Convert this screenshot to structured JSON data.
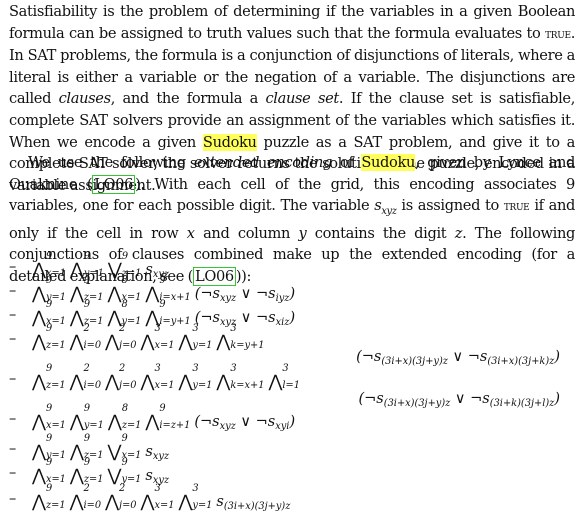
{
  "para1": {
    "s1": "Satisfiability is the problem of determining if the variables in a given Boolean formula can be assigned to truth values such that the formula evaluates to ",
    "true": "true",
    "s2": ". In SAT problems, the formula is a conjunction of disjunctions of literals, where a literal is either a variable or the negation of a variable. The disjunctions are called ",
    "clauses": "clauses",
    "s3": ", and the formula a ",
    "clause_set": "clause set",
    "s4": ". If the clause set is satisfiable, complete SAT solvers provide an assignment of the variables which satisfies it. When we encode a given ",
    "sudoku": "Sudoku",
    "s5": " puzzle as a SAT problem, and give it to a complete SAT solver, the solver returns the solution to the puzzle, encoded in a variable assignment."
  },
  "para2": {
    "s1": "We use the following ",
    "ext": "extended encoding",
    "s2": " of ",
    "sudoku": "Sudoku",
    "s3": ", given by Lynce and Ouaknine (",
    "cite": "LO06",
    "s4": "). With each cell of the grid, this encoding associates 9 variables, one for each possible digit. The variable ",
    "var": "s",
    "var_sub": "xyz",
    "s5": " is assigned to ",
    "true": "true",
    "s6": " if and only if the cell in row ",
    "x": "x",
    "s7": " and column ",
    "y": "y",
    "s8": " contains the digit ",
    "z": "z",
    "s9": ". The following conjunctions of clauses combined make up the extended encoding (for a detailed explanation, see (",
    "cite2": "LO06",
    "s10": "))"
  },
  "formulas": [
    {
      "bullet": "–",
      "ops": [
        [
          "⋀",
          "x=1",
          "9"
        ],
        [
          "⋀",
          "y=1",
          "9"
        ],
        [
          "⋁",
          "z=1",
          "9"
        ]
      ],
      "tail": "s",
      "tail_sub": "xyz"
    },
    {
      "bullet": "–",
      "ops": [
        [
          "⋀",
          "y=1",
          "9"
        ],
        [
          "⋀",
          "z=1",
          "9"
        ],
        [
          "⋀",
          "x=1",
          "8"
        ],
        [
          "⋀",
          "i=x+1",
          "9"
        ]
      ],
      "tail": "(¬s",
      "tail_sub": "xyz",
      "tail2": " ∨ ¬s",
      "tail2_sub": "iyz",
      "tail3": ")"
    },
    {
      "bullet": "–",
      "ops": [
        [
          "⋀",
          "x=1",
          "9"
        ],
        [
          "⋀",
          "z=1",
          "9"
        ],
        [
          "⋀",
          "y=1",
          "8"
        ],
        [
          "⋀",
          "i=y+1",
          "9"
        ]
      ],
      "tail": "(¬s",
      "tail_sub": "xyz",
      "tail2": " ∨ ¬s",
      "tail2_sub": "xiz",
      "tail3": ")"
    },
    {
      "bullet": "–",
      "ops": [
        [
          "⋀",
          "z=1",
          "9"
        ],
        [
          "⋀",
          "i=0",
          "2"
        ],
        [
          "⋀",
          "j=0",
          "2"
        ],
        [
          "⋀",
          "x=1",
          "3"
        ],
        [
          "⋀",
          "y=1",
          "3"
        ],
        [
          "⋀",
          "k=y+1",
          "3"
        ]
      ],
      "cont": "(¬s",
      "cont_sub": "(3i+x)(3j+y)z",
      "cont2": " ∨ ¬s",
      "cont2_sub": "(3i+x)(3j+k)z",
      "cont3": ")"
    },
    {
      "bullet": "–",
      "ops": [
        [
          "⋀",
          "z=1",
          "9"
        ],
        [
          "⋀",
          "i=0",
          "2"
        ],
        [
          "⋀",
          "j=0",
          "2"
        ],
        [
          "⋀",
          "x=1",
          "3"
        ],
        [
          "⋀",
          "y=1",
          "3"
        ],
        [
          "⋀",
          "k=x+1",
          "3"
        ],
        [
          "⋀",
          "l=1",
          "3"
        ]
      ],
      "cont": "(¬s",
      "cont_sub": "(3i+x)(3j+y)z",
      "cont2": " ∨ ¬s",
      "cont2_sub": "(3i+k)(3j+l)z",
      "cont3": ")"
    },
    {
      "bullet": "–",
      "ops": [
        [
          "⋀",
          "x=1",
          "9"
        ],
        [
          "⋀",
          "y=1",
          "9"
        ],
        [
          "⋀",
          "z=1",
          "8"
        ],
        [
          "⋀",
          "i=z+1",
          "9"
        ]
      ],
      "tail": "(¬s",
      "tail_sub": "xyz",
      "tail2": " ∨ ¬s",
      "tail2_sub": "xyi",
      "tail3": ")"
    },
    {
      "bullet": "–",
      "ops": [
        [
          "⋀",
          "y=1",
          "9"
        ],
        [
          "⋀",
          "z=1",
          "9"
        ],
        [
          "⋁",
          "x=1",
          "9"
        ]
      ],
      "tail": "s",
      "tail_sub": "xyz"
    },
    {
      "bullet": "–",
      "ops": [
        [
          "⋀",
          "x=1",
          "9"
        ],
        [
          "⋀",
          "z=1",
          "9"
        ],
        [
          "⋁",
          "y=1",
          "9"
        ]
      ],
      "tail": "s",
      "tail_sub": "xyz"
    },
    {
      "bullet": "–",
      "ops": [
        [
          "⋀",
          "z=1",
          "9"
        ],
        [
          "⋀",
          "i=0",
          "2"
        ],
        [
          "⋀",
          "j=0",
          "2"
        ],
        [
          "⋀",
          "x=1",
          "3"
        ],
        [
          "⋀",
          "y=1",
          "3"
        ]
      ],
      "tail": "s",
      "tail_sub": "(3i+x)(3j+y)z"
    }
  ]
}
